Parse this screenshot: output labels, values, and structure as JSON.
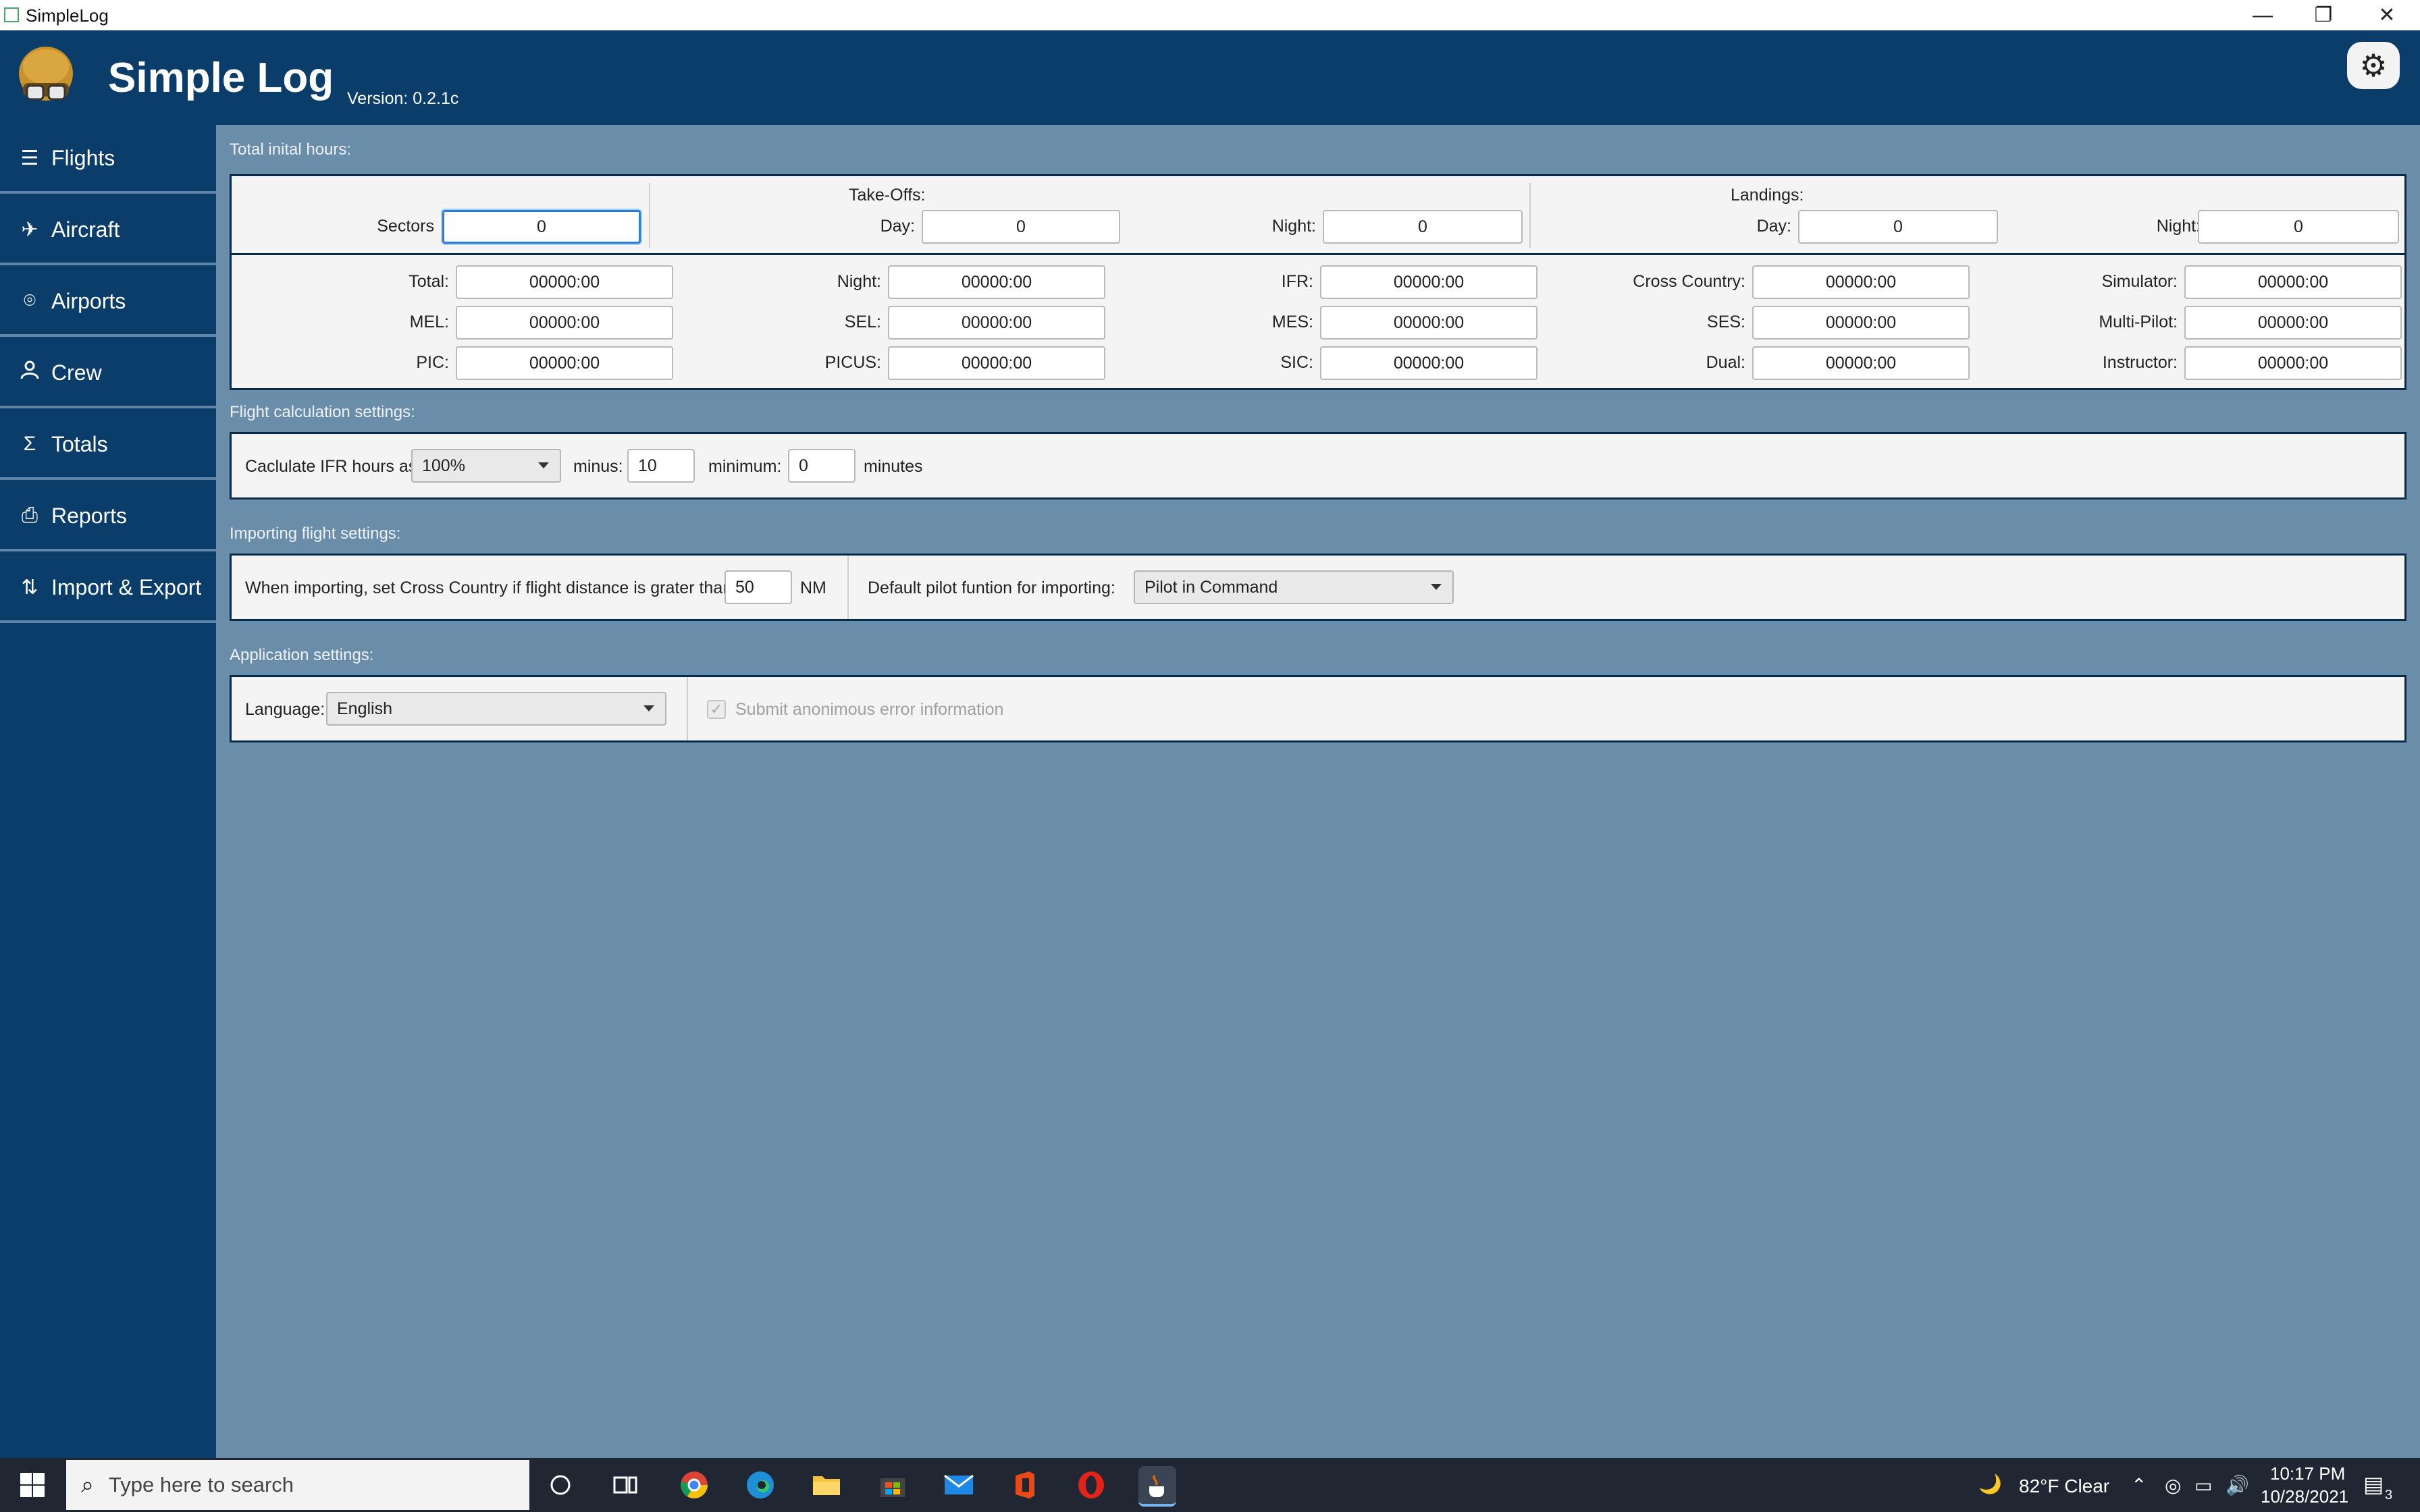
{
  "window": {
    "title": "SimpleLog",
    "minimize": "—",
    "restore": "❐",
    "close": "✕"
  },
  "header": {
    "app_name": "Simple Log",
    "version": "Version: 0.2.1c",
    "settings_icon": "gear-icon"
  },
  "sidebar": {
    "items": [
      {
        "label": "Flights",
        "icon": "list-icon",
        "glyph": "☰"
      },
      {
        "label": "Aircraft",
        "icon": "airplane-icon",
        "glyph": "✈"
      },
      {
        "label": "Airports",
        "icon": "map-pin-icon",
        "glyph": "⌾"
      },
      {
        "label": "Crew",
        "icon": "person-icon",
        "glyph": "👤"
      },
      {
        "label": "Totals",
        "icon": "sigma-icon",
        "glyph": "Σ"
      },
      {
        "label": "Reports",
        "icon": "printer-icon",
        "glyph": "⎙"
      },
      {
        "label": "Import & Export",
        "icon": "import-export-icon",
        "glyph": "⇅"
      }
    ]
  },
  "initial_hours": {
    "section_label": "Total inital hours:",
    "sectors": {
      "label": "Sectors",
      "value": "0"
    },
    "takeoffs": {
      "label": "Take-Offs:",
      "day_label": "Day:",
      "day_value": "0",
      "night_label": "Night:",
      "night_value": "0"
    },
    "landings": {
      "label": "Landings:",
      "day_label": "Day:",
      "day_value": "0",
      "night_label": "Night:",
      "night_value": "0"
    },
    "times": [
      {
        "label": "Total:",
        "value": "00000:00"
      },
      {
        "label": "Night:",
        "value": "00000:00"
      },
      {
        "label": "IFR:",
        "value": "00000:00"
      },
      {
        "label": "Cross Country:",
        "value": "00000:00"
      },
      {
        "label": "Simulator:",
        "value": "00000:00"
      },
      {
        "label": "MEL:",
        "value": "00000:00"
      },
      {
        "label": "SEL:",
        "value": "00000:00"
      },
      {
        "label": "MES:",
        "value": "00000:00"
      },
      {
        "label": "SES:",
        "value": "00000:00"
      },
      {
        "label": "Multi-Pilot:",
        "value": "00000:00"
      },
      {
        "label": "PIC:",
        "value": "00000:00"
      },
      {
        "label": "PICUS:",
        "value": "00000:00"
      },
      {
        "label": "SIC:",
        "value": "00000:00"
      },
      {
        "label": "Dual:",
        "value": "00000:00"
      },
      {
        "label": "Instructor:",
        "value": "00000:00"
      }
    ]
  },
  "flight_calc": {
    "section_label": "Flight calculation settings:",
    "ifr_label": "Caclulate IFR hours as:",
    "ifr_value": "100%",
    "minus_label": "minus:",
    "minus_value": "10",
    "minimum_label": "minimum:",
    "minimum_value": "0",
    "minutes_label": "minutes"
  },
  "importing": {
    "section_label": "Importing flight settings:",
    "cross_country_label": "When importing, set Cross Country if flight distance is grater than:",
    "cross_country_value": "50",
    "unit": "NM",
    "pilot_function_label": "Default pilot funtion for importing:",
    "pilot_function_value": "Pilot in Command"
  },
  "application": {
    "section_label": "Application settings:",
    "language_label": "Language:",
    "language_value": "English",
    "error_info_label": "Submit anonimous error information",
    "error_info_checked": true
  },
  "taskbar": {
    "search_placeholder": "Type here to search",
    "weather": "82°F  Clear",
    "time": "10:17 PM",
    "date": "10/28/2021",
    "notifications": "3"
  }
}
